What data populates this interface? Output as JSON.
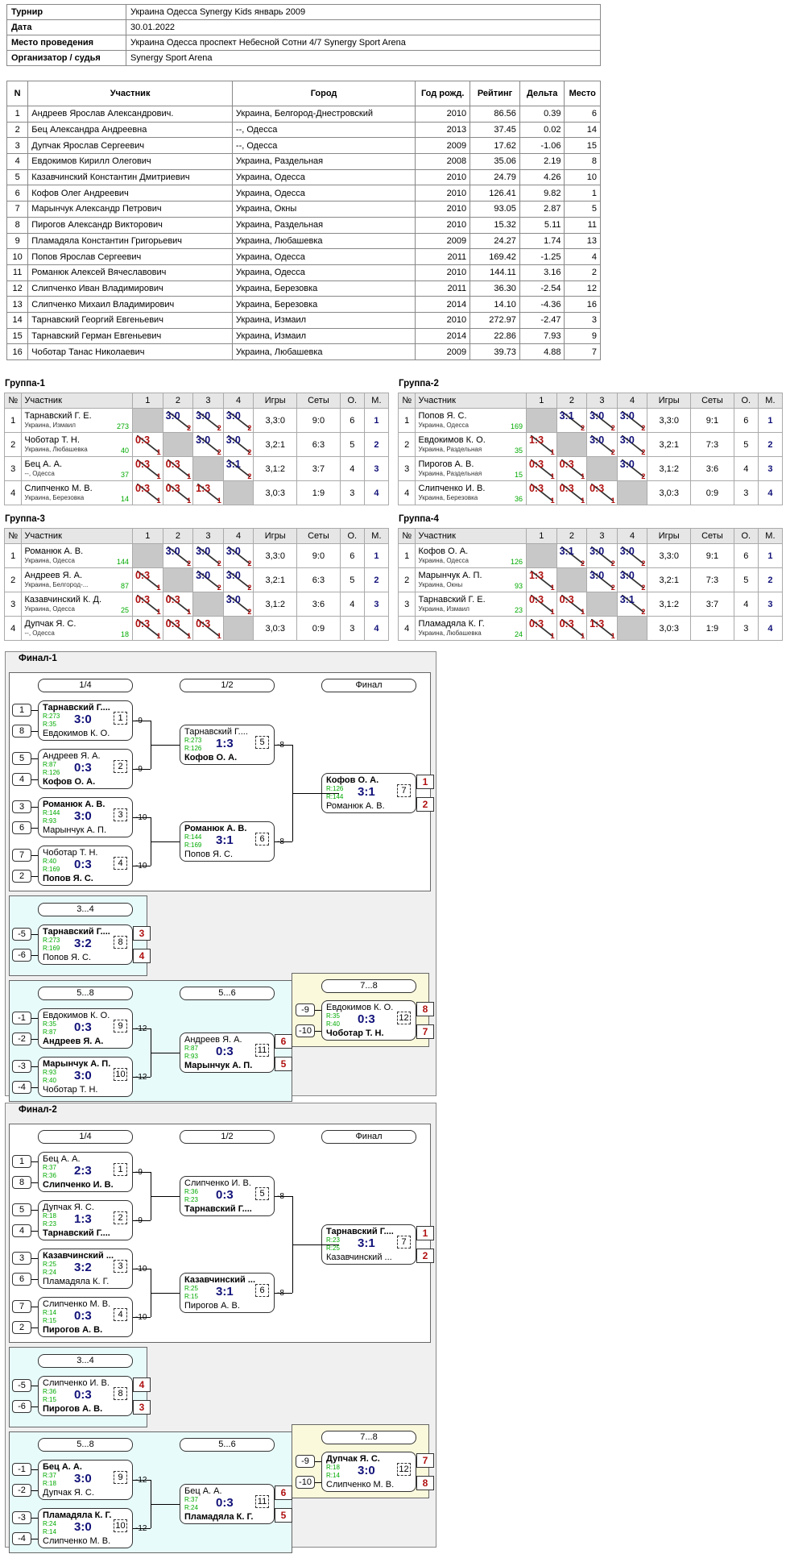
{
  "info": [
    [
      "Турнир",
      "Украина Одесса Synergy Kids январь 2009"
    ],
    [
      "Дата",
      "30.01.2022"
    ],
    [
      "Место проведения",
      "Украина Одесса проспект Небесной Сотни 4/7 Synergy Sport Arena"
    ],
    [
      "Организатор / судья",
      "Synergy Sport Arena"
    ]
  ],
  "part_head": [
    "N",
    "Участник",
    "Город",
    "Год рожд.",
    "Рейтинг",
    "Дельта",
    "Место"
  ],
  "participants": [
    [
      "1",
      "Андреев Ярослав Александрович.",
      "Украина, Белгород-Днестровский",
      "2010",
      "86.56",
      "0.39",
      "6"
    ],
    [
      "2",
      "Бец Александра Андреевна",
      "--, Одесса",
      "2013",
      "37.45",
      "0.02",
      "14"
    ],
    [
      "3",
      "Дупчак Ярослав Сергеевич",
      "--, Одесса",
      "2009",
      "17.62",
      "-1.06",
      "15"
    ],
    [
      "4",
      "Евдокимов Кирилл Олегович",
      "Украина, Раздельная",
      "2008",
      "35.06",
      "2.19",
      "8"
    ],
    [
      "5",
      "Казавчинский Константин Дмитриевич",
      "Украина, Одесса",
      "2010",
      "24.79",
      "4.26",
      "10"
    ],
    [
      "6",
      "Кофов Олег Андреевич",
      "Украина, Одесса",
      "2010",
      "126.41",
      "9.82",
      "1"
    ],
    [
      "7",
      "Марынчук Александр Петрович",
      "Украина, Окны",
      "2010",
      "93.05",
      "2.87",
      "5"
    ],
    [
      "8",
      "Пирогов Александр Викторович",
      "Украина, Раздельная",
      "2010",
      "15.32",
      "5.11",
      "11"
    ],
    [
      "9",
      "Пламадяла Константин Григорьевич",
      "Украина, Любашевка",
      "2009",
      "24.27",
      "1.74",
      "13"
    ],
    [
      "10",
      "Попов Ярослав Сергеевич",
      "Украина, Одесса",
      "2011",
      "169.42",
      "-1.25",
      "4"
    ],
    [
      "11",
      "Романюк Алексей Вячеславович",
      "Украина, Одесса",
      "2010",
      "144.11",
      "3.16",
      "2"
    ],
    [
      "12",
      "Слипченко Иван Владимирович",
      "Украина, Березовка",
      "2011",
      "36.30",
      "-2.54",
      "12"
    ],
    [
      "13",
      "Слипченко Михаил Владимирович",
      "Украина, Березовка",
      "2014",
      "14.10",
      "-4.36",
      "16"
    ],
    [
      "14",
      "Тарнавский Георгий Евгеньевич",
      "Украина, Измаил",
      "2010",
      "272.97",
      "-2.47",
      "3"
    ],
    [
      "15",
      "Тарнавский Герман Евгеньевич",
      "Украина, Измаил",
      "2014",
      "22.86",
      "7.93",
      "9"
    ],
    [
      "16",
      "Чоботар Танас Николаевич",
      "Украина, Любашевка",
      "2009",
      "39.73",
      "4.88",
      "7"
    ]
  ],
  "group_head": [
    "№",
    "Участник",
    "1",
    "2",
    "3",
    "4",
    "Игры",
    "Сеты",
    "О.",
    "М."
  ],
  "groups": [
    {
      "title": "Группа-1",
      "rows": [
        {
          "n": "1",
          "name": "Тарнавский Г. Е.",
          "city": "Украина, Измаил",
          "rat": "273",
          "res": [
            null,
            [
              "3:0",
              "2",
              "w"
            ],
            [
              "3:0",
              "2",
              "w"
            ],
            [
              "3:0",
              "2",
              "w"
            ]
          ],
          "games": "3,3:0",
          "sets": "9:0",
          "pts": "6",
          "place": "1"
        },
        {
          "n": "2",
          "name": "Чоботар Т. Н.",
          "city": "Украина, Любашевка",
          "rat": "40",
          "res": [
            [
              "0:3",
              "1",
              "l"
            ],
            null,
            [
              "3:0",
              "2",
              "w"
            ],
            [
              "3:0",
              "2",
              "w"
            ]
          ],
          "games": "3,2:1",
          "sets": "6:3",
          "pts": "5",
          "place": "2"
        },
        {
          "n": "3",
          "name": "Бец А. А.",
          "city": "--, Одесса",
          "rat": "37",
          "res": [
            [
              "0:3",
              "1",
              "l"
            ],
            [
              "0:3",
              "1",
              "l"
            ],
            null,
            [
              "3:1",
              "2",
              "w"
            ]
          ],
          "games": "3,1:2",
          "sets": "3:7",
          "pts": "4",
          "place": "3"
        },
        {
          "n": "4",
          "name": "Слипченко М. В.",
          "city": "Украина, Березовка",
          "rat": "14",
          "res": [
            [
              "0:3",
              "1",
              "l"
            ],
            [
              "0:3",
              "1",
              "l"
            ],
            [
              "1:3",
              "1",
              "l"
            ],
            null
          ],
          "games": "3,0:3",
          "sets": "1:9",
          "pts": "3",
          "place": "4"
        }
      ]
    },
    {
      "title": "Группа-2",
      "rows": [
        {
          "n": "1",
          "name": "Попов Я. С.",
          "city": "Украина, Одесса",
          "rat": "169",
          "res": [
            null,
            [
              "3:1",
              "2",
              "w"
            ],
            [
              "3:0",
              "2",
              "w"
            ],
            [
              "3:0",
              "2",
              "w"
            ]
          ],
          "games": "3,3:0",
          "sets": "9:1",
          "pts": "6",
          "place": "1"
        },
        {
          "n": "2",
          "name": "Евдокимов К. О.",
          "city": "Украина, Раздельная",
          "rat": "35",
          "res": [
            [
              "1:3",
              "1",
              "l"
            ],
            null,
            [
              "3:0",
              "2",
              "w"
            ],
            [
              "3:0",
              "2",
              "w"
            ]
          ],
          "games": "3,2:1",
          "sets": "7:3",
          "pts": "5",
          "place": "2"
        },
        {
          "n": "3",
          "name": "Пирогов А. В.",
          "city": "Украина, Раздельная",
          "rat": "15",
          "res": [
            [
              "0:3",
              "1",
              "l"
            ],
            [
              "0:3",
              "1",
              "l"
            ],
            null,
            [
              "3:0",
              "2",
              "w"
            ]
          ],
          "games": "3,1:2",
          "sets": "3:6",
          "pts": "4",
          "place": "3"
        },
        {
          "n": "4",
          "name": "Слипченко И. В.",
          "city": "Украина, Березовка",
          "rat": "36",
          "res": [
            [
              "0:3",
              "1",
              "l"
            ],
            [
              "0:3",
              "1",
              "l"
            ],
            [
              "0:3",
              "1",
              "l"
            ],
            null
          ],
          "games": "3,0:3",
          "sets": "0:9",
          "pts": "3",
          "place": "4"
        }
      ]
    },
    {
      "title": "Группа-3",
      "rows": [
        {
          "n": "1",
          "name": "Романюк А. В.",
          "city": "Украина, Одесса",
          "rat": "144",
          "res": [
            null,
            [
              "3:0",
              "2",
              "w"
            ],
            [
              "3:0",
              "2",
              "w"
            ],
            [
              "3:0",
              "2",
              "w"
            ]
          ],
          "games": "3,3:0",
          "sets": "9:0",
          "pts": "6",
          "place": "1"
        },
        {
          "n": "2",
          "name": "Андреев Я. А.",
          "city": "Украина, Белгород-...",
          "rat": "87",
          "res": [
            [
              "0:3",
              "1",
              "l"
            ],
            null,
            [
              "3:0",
              "2",
              "w"
            ],
            [
              "3:0",
              "2",
              "w"
            ]
          ],
          "games": "3,2:1",
          "sets": "6:3",
          "pts": "5",
          "place": "2"
        },
        {
          "n": "3",
          "name": "Казавчинский К. Д.",
          "city": "Украина, Одесса",
          "rat": "25",
          "res": [
            [
              "0:3",
              "1",
              "l"
            ],
            [
              "0:3",
              "1",
              "l"
            ],
            null,
            [
              "3:0",
              "2",
              "w"
            ]
          ],
          "games": "3,1:2",
          "sets": "3:6",
          "pts": "4",
          "place": "3"
        },
        {
          "n": "4",
          "name": "Дупчак Я. С.",
          "city": "--, Одесса",
          "rat": "18",
          "res": [
            [
              "0:3",
              "1",
              "l"
            ],
            [
              "0:3",
              "1",
              "l"
            ],
            [
              "0:3",
              "1",
              "l"
            ],
            null
          ],
          "games": "3,0:3",
          "sets": "0:9",
          "pts": "3",
          "place": "4"
        }
      ]
    },
    {
      "title": "Группа-4",
      "rows": [
        {
          "n": "1",
          "name": "Кофов О. А.",
          "city": "Украина, Одесса",
          "rat": "126",
          "res": [
            null,
            [
              "3:1",
              "2",
              "w"
            ],
            [
              "3:0",
              "2",
              "w"
            ],
            [
              "3:0",
              "2",
              "w"
            ]
          ],
          "games": "3,3:0",
          "sets": "9:1",
          "pts": "6",
          "place": "1"
        },
        {
          "n": "2",
          "name": "Марынчук А. П.",
          "city": "Украина, Окны",
          "rat": "93",
          "res": [
            [
              "1:3",
              "1",
              "l"
            ],
            null,
            [
              "3:0",
              "2",
              "w"
            ],
            [
              "3:0",
              "2",
              "w"
            ]
          ],
          "games": "3,2:1",
          "sets": "7:3",
          "pts": "5",
          "place": "2"
        },
        {
          "n": "3",
          "name": "Тарнавский Г. Е.",
          "city": "Украина, Измаил",
          "rat": "23",
          "res": [
            [
              "0:3",
              "1",
              "l"
            ],
            [
              "0:3",
              "1",
              "l"
            ],
            null,
            [
              "3:1",
              "2",
              "w"
            ]
          ],
          "games": "3,1:2",
          "sets": "3:7",
          "pts": "4",
          "place": "3"
        },
        {
          "n": "4",
          "name": "Пламадяла К. Г.",
          "city": "Украина, Любашевка",
          "rat": "24",
          "res": [
            [
              "0:3",
              "1",
              "l"
            ],
            [
              "0:3",
              "1",
              "l"
            ],
            [
              "1:3",
              "1",
              "l"
            ],
            null
          ],
          "games": "3,0:3",
          "sets": "1:9",
          "pts": "3",
          "place": "4"
        }
      ]
    }
  ],
  "finals": [
    {
      "title": "Финал-1",
      "hdr": [
        "1/4",
        "1/2",
        "Финал",
        "3...4",
        "5...8",
        "5...6",
        "7...8"
      ],
      "matches": [
        {
          "p1": "Тарнавский Г....",
          "p2": "Евдокимов К. О.",
          "r1": "R:273",
          "r2": "R:35",
          "score": "3:0",
          "num": "1",
          "win": 1,
          "next": "-9",
          "s1": "1",
          "s2": "8"
        },
        {
          "p1": "Андреев Я. А.",
          "p2": "Кофов О. А.",
          "r1": "R:87",
          "r2": "R:126",
          "score": "0:3",
          "num": "2",
          "win": 2,
          "next": "-9",
          "s1": "5",
          "s2": "4"
        },
        {
          "p1": "Романюк А. В.",
          "p2": "Марынчук А. П.",
          "r1": "R:144",
          "r2": "R:93",
          "score": "3:0",
          "num": "3",
          "win": 1,
          "next": "-10",
          "s1": "3",
          "s2": "6"
        },
        {
          "p1": "Чоботар Т. Н.",
          "p2": "Попов Я. С.",
          "r1": "R:40",
          "r2": "R:169",
          "score": "0:3",
          "num": "4",
          "win": 2,
          "next": "-10",
          "s1": "7",
          "s2": "2"
        },
        {
          "p1": "Тарнавский Г....",
          "p2": "Кофов О. А.",
          "r1": "R:273",
          "r2": "R:126",
          "score": "1:3",
          "num": "5",
          "win": 2,
          "next": "-8"
        },
        {
          "p1": "Романюк А. В.",
          "p2": "Попов Я. С.",
          "r1": "R:144",
          "r2": "R:169",
          "score": "3:1",
          "num": "6",
          "win": 1,
          "next": "-8"
        },
        {
          "p1": "Кофов О. А.",
          "p2": "Романюк А. В.",
          "r1": "R:126",
          "r2": "R:144",
          "score": "3:1",
          "num": "7",
          "win": 1,
          "pl1": "1",
          "pl2": "2"
        },
        {
          "p1": "Тарнавский Г....",
          "p2": "Попов Я. С.",
          "r1": "R:273",
          "r2": "R:169",
          "score": "3:2",
          "num": "8",
          "win": 1,
          "s1": "-5",
          "s2": "-6",
          "pl1": "3",
          "pl2": "4"
        },
        {
          "p1": "Евдокимов К. О.",
          "p2": "Андреев Я. А.",
          "r1": "R:35",
          "r2": "R:87",
          "score": "0:3",
          "num": "9",
          "win": 2,
          "next": "-12",
          "s1": "-1",
          "s2": "-2"
        },
        {
          "p1": "Марынчук А. П.",
          "p2": "Чоботар Т. Н.",
          "r1": "R:93",
          "r2": "R:40",
          "score": "3:0",
          "num": "10",
          "win": 1,
          "next": "-12",
          "s1": "-3",
          "s2": "-4"
        },
        {
          "p1": "Андреев Я. А.",
          "p2": "Марынчук А. П.",
          "r1": "R:87",
          "r2": "R:93",
          "score": "0:3",
          "num": "11",
          "win": 2,
          "pl1": "6",
          "pl2": "5"
        },
        {
          "p1": "Евдокимов К. О.",
          "p2": "Чоботар Т. Н.",
          "r1": "R:35",
          "r2": "R:40",
          "score": "0:3",
          "num": "12",
          "win": 2,
          "s1": "-9",
          "s2": "-10",
          "pl1": "8",
          "pl2": "7"
        }
      ]
    },
    {
      "title": "Финал-2",
      "hdr": [
        "1/4",
        "1/2",
        "Финал",
        "3...4",
        "5...8",
        "5...6",
        "7...8"
      ],
      "matches": [
        {
          "p1": "Бец А. А.",
          "p2": "Слипченко И. В.",
          "r1": "R:37",
          "r2": "R:36",
          "score": "2:3",
          "num": "1",
          "win": 2,
          "next": "-9",
          "s1": "1",
          "s2": "8"
        },
        {
          "p1": "Дупчак Я. С.",
          "p2": "Тарнавский Г....",
          "r1": "R:18",
          "r2": "R:23",
          "score": "1:3",
          "num": "2",
          "win": 2,
          "next": "-9",
          "s1": "5",
          "s2": "4"
        },
        {
          "p1": "Казавчинский ...",
          "p2": "Пламадяла К. Г.",
          "r1": "R:25",
          "r2": "R:24",
          "score": "3:2",
          "num": "3",
          "win": 1,
          "next": "-10",
          "s1": "3",
          "s2": "6"
        },
        {
          "p1": "Слипченко М. В.",
          "p2": "Пирогов А. В.",
          "r1": "R:14",
          "r2": "R:15",
          "score": "0:3",
          "num": "4",
          "win": 2,
          "next": "-10",
          "s1": "7",
          "s2": "2"
        },
        {
          "p1": "Слипченко И. В.",
          "p2": "Тарнавский Г....",
          "r1": "R:36",
          "r2": "R:23",
          "score": "0:3",
          "num": "5",
          "win": 2,
          "next": "-8"
        },
        {
          "p1": "Казавчинский ...",
          "p2": "Пирогов А. В.",
          "r1": "R:25",
          "r2": "R:15",
          "score": "3:1",
          "num": "6",
          "win": 1,
          "next": "-8"
        },
        {
          "p1": "Тарнавский Г....",
          "p2": "Казавчинский ...",
          "r1": "R:23",
          "r2": "R:25",
          "score": "3:1",
          "num": "7",
          "win": 1,
          "pl1": "1",
          "pl2": "2"
        },
        {
          "p1": "Слипченко И. В.",
          "p2": "Пирогов А. В.",
          "r1": "R:36",
          "r2": "R:15",
          "score": "0:3",
          "num": "8",
          "win": 2,
          "s1": "-5",
          "s2": "-6",
          "pl1": "4",
          "pl2": "3"
        },
        {
          "p1": "Бец А. А.",
          "p2": "Дупчак Я. С.",
          "r1": "R:37",
          "r2": "R:18",
          "score": "3:0",
          "num": "9",
          "win": 1,
          "next": "-12",
          "s1": "-1",
          "s2": "-2"
        },
        {
          "p1": "Пламадяла К. Г.",
          "p2": "Слипченко М. В.",
          "r1": "R:24",
          "r2": "R:14",
          "score": "3:0",
          "num": "10",
          "win": 1,
          "next": "-12",
          "s1": "-3",
          "s2": "-4"
        },
        {
          "p1": "Бец А. А.",
          "p2": "Пламадяла К. Г.",
          "r1": "R:37",
          "r2": "R:24",
          "score": "0:3",
          "num": "11",
          "win": 2,
          "pl1": "6",
          "pl2": "5"
        },
        {
          "p1": "Дупчак Я. С.",
          "p2": "Слипченко М. В.",
          "r1": "R:18",
          "r2": "R:14",
          "score": "3:0",
          "num": "12",
          "win": 1,
          "s1": "-9",
          "s2": "-10",
          "pl1": "7",
          "pl2": "8"
        }
      ]
    }
  ]
}
